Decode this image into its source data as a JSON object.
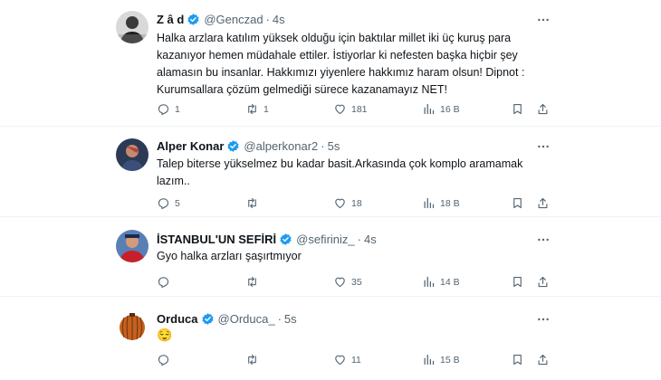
{
  "tweets": [
    {
      "name": "Z â d",
      "handle": "@Genczad",
      "time": "4s",
      "lines": [
        "Halka arzlara katılım yüksek olduğu için baktılar millet iki üç kuruş para",
        "kazanıyor hemen müdahale ettiler. İstiyorlar ki nefesten başka hiçbir şey",
        "alamasın bu insanlar. Hakkımızı yiyenlere hakkımız haram olsun! Dipnot :",
        "Kurumsallara çözüm gelmediği sürece kazanamayız NET!"
      ],
      "replies": "1",
      "retweets": "1",
      "likes": "181",
      "views": "16 B"
    },
    {
      "name": "Alper Konar",
      "handle": "@alperkonar2",
      "time": "5s",
      "lines": [
        "Talep biterse yükselmez bu kadar basit.Arkasında çok komplo aramamak",
        "lazım.."
      ],
      "replies": "5",
      "retweets": "",
      "likes": "18",
      "views": "18 B"
    },
    {
      "name": "İSTANBUL'UN SEFİRİ",
      "handle": "@sefiriniz_",
      "time": "4s",
      "lines": [
        "Gyo halka arzları şaşırtmıyor"
      ],
      "replies": "",
      "retweets": "",
      "likes": "35",
      "views": "14 B"
    },
    {
      "name": "Orduca",
      "handle": "@Orduca_",
      "time": "5s",
      "lines": [
        "😌"
      ],
      "replies": "",
      "retweets": "",
      "likes": "11",
      "views": "15 B"
    }
  ],
  "separator": "·",
  "colors": {
    "verified": "#1d9bf0",
    "text": "#0f1419",
    "secondary": "#536471",
    "divider": "#eff3f4"
  },
  "icons": [
    "more-icon",
    "reply-icon",
    "retweet-icon",
    "like-icon",
    "views-icon",
    "bookmark-icon",
    "share-icon",
    "verified-badge-icon"
  ]
}
